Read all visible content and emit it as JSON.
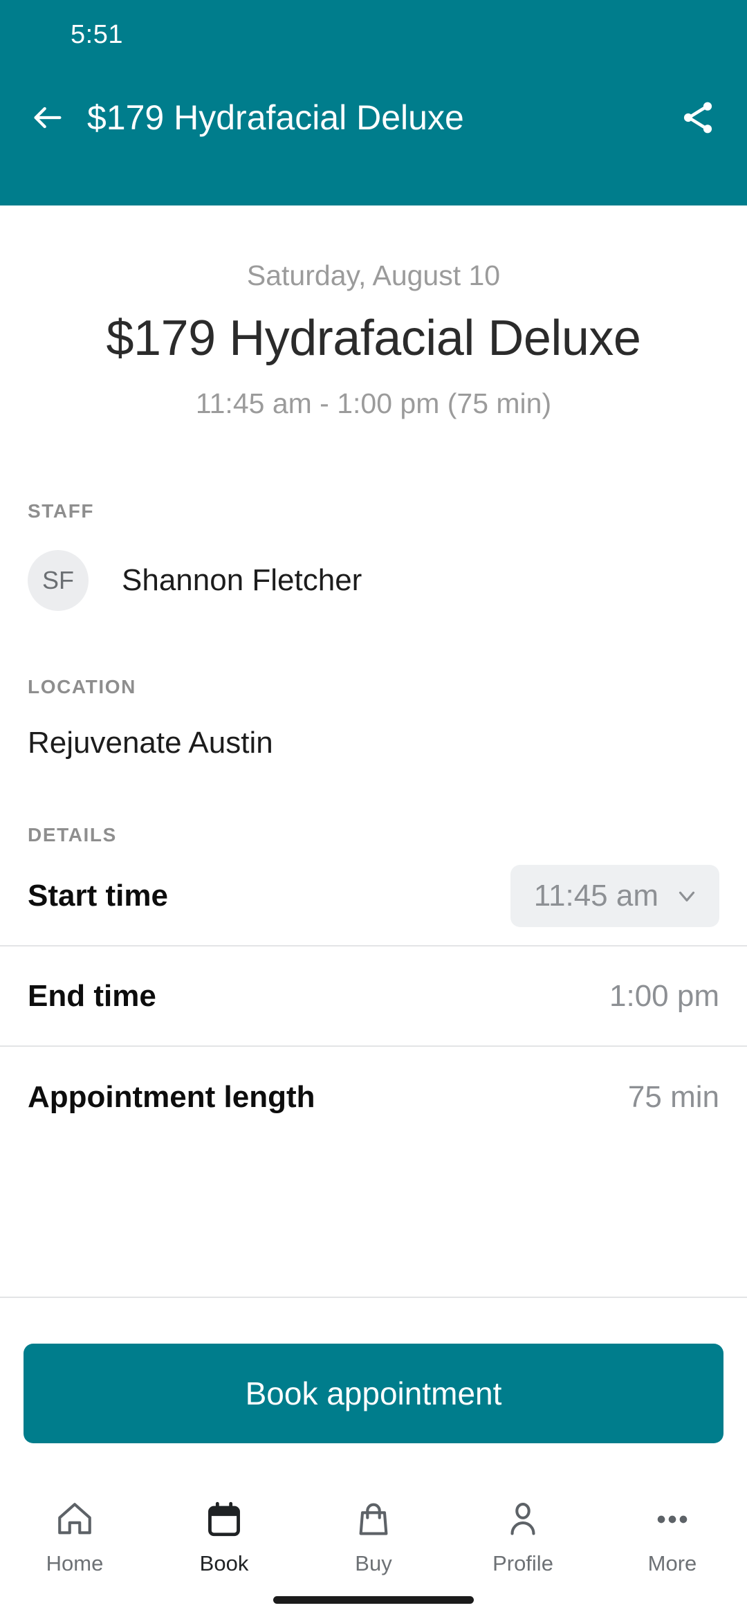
{
  "status_bar": {
    "time": "5:51"
  },
  "app_bar": {
    "title": "$179 Hydrafacial Deluxe",
    "back_icon": "arrow-left-icon",
    "share_icon": "share-icon"
  },
  "hero": {
    "date": "Saturday, August 10",
    "title": "$179 Hydrafacial Deluxe",
    "time_range": "11:45 am - 1:00 pm (75 min)"
  },
  "staff": {
    "label": "STAFF",
    "initials": "SF",
    "name": "Shannon Fletcher"
  },
  "location": {
    "label": "LOCATION",
    "value": "Rejuvenate Austin"
  },
  "details": {
    "label": "DETAILS",
    "rows": [
      {
        "label": "Start time",
        "value": "11:45 am",
        "type": "dropdown",
        "chevron_icon": "chevron-down-icon"
      },
      {
        "label": "End time",
        "value": "1:00 pm",
        "type": "text"
      },
      {
        "label": "Appointment length",
        "value": "75 min",
        "type": "text"
      }
    ]
  },
  "cta": {
    "label": "Book appointment"
  },
  "tabbar": {
    "active_index": 1,
    "items": [
      {
        "label": "Home",
        "icon": "home-icon"
      },
      {
        "label": "Book",
        "icon": "calendar-icon"
      },
      {
        "label": "Buy",
        "icon": "shopping-bag-icon"
      },
      {
        "label": "Profile",
        "icon": "person-icon"
      },
      {
        "label": "More",
        "icon": "ellipsis-icon"
      }
    ]
  },
  "colors": {
    "brand_teal": "#007D8C",
    "muted_text": "#9b9b9b",
    "pill_bg": "#eef0f2",
    "divider": "#e3e4e6"
  }
}
